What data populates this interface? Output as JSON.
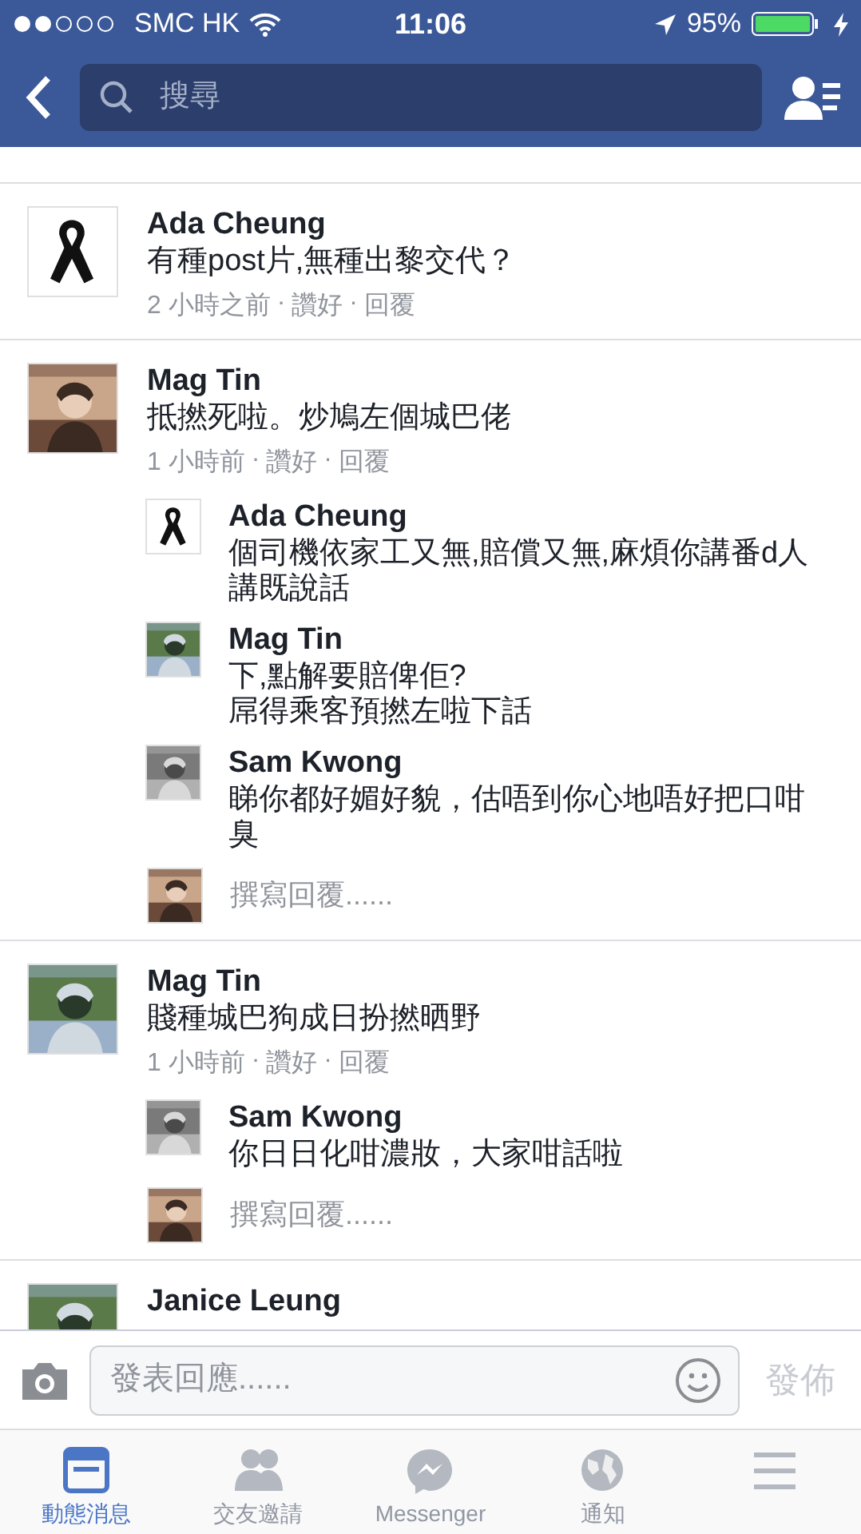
{
  "status_bar": {
    "carrier": "SMC HK",
    "time": "11:06",
    "battery": "95%"
  },
  "nav": {
    "search": {
      "placeholder": "搜尋"
    }
  },
  "comments": [
    {
      "author": "Ada Cheung",
      "avatar": {
        "kind": "ribbon"
      },
      "text": "有種post片,無種出黎交代？",
      "meta": [
        "2 小時之前",
        "·",
        "讚好",
        "·",
        "回覆"
      ]
    },
    {
      "author": "Mag Tin",
      "avatar": {
        "kind": "picture"
      },
      "text": "抵撚死啦。炒鳩左個城巴佬",
      "meta": [
        "1 小時前",
        "·",
        "讚好",
        "·",
        "回覆"
      ],
      "replies": [
        {
          "author": "Ada Cheung",
          "avatar": {
            "kind": "ribbon"
          },
          "text": "個司機依家工又無,賠償又無,麻煩你講番d人講既說話"
        },
        {
          "author": "Mag Tin",
          "avatar": {
            "kind": "picture"
          },
          "text": "下,點解要賠俾佢?\n屌得乘客預撚左啦下話"
        },
        {
          "author": "Sam Kwong",
          "avatar": {
            "kind": "picture"
          },
          "text": "睇你都好媚好貌，估唔到你心地唔好把口咁臭"
        }
      ],
      "reply_field": {
        "placeholder": "撰寫回覆......"
      }
    },
    {
      "author": "Mag Tin",
      "avatar": {
        "kind": "picture"
      },
      "text": "賤種城巴狗成日扮撚晒野",
      "meta": [
        "1 小時前",
        "·",
        "讚好",
        "·",
        "回覆"
      ],
      "replies": [
        {
          "author": "Sam Kwong",
          "avatar": {
            "kind": "picture"
          },
          "text": "你日日化咁濃妝，大家咁話啦"
        }
      ],
      "reply_field": {
        "placeholder": "撰寫回覆......"
      }
    },
    {
      "author": "Janice Leung",
      "avatar": {
        "kind": "picture"
      }
    }
  ],
  "composer": {
    "placeholder": "發表回應......",
    "send": {
      "label": "發佈",
      "disabled": true
    }
  },
  "tabs": [
    {
      "kind": "feed",
      "label": "動態消息",
      "selected": true
    },
    {
      "kind": "friends",
      "label": "交友邀請",
      "selected": false
    },
    {
      "kind": "messenger",
      "label": "Messenger",
      "selected": false
    },
    {
      "kind": "globe",
      "label": "通知",
      "selected": false
    },
    {
      "kind": "menu",
      "selected": false
    }
  ]
}
